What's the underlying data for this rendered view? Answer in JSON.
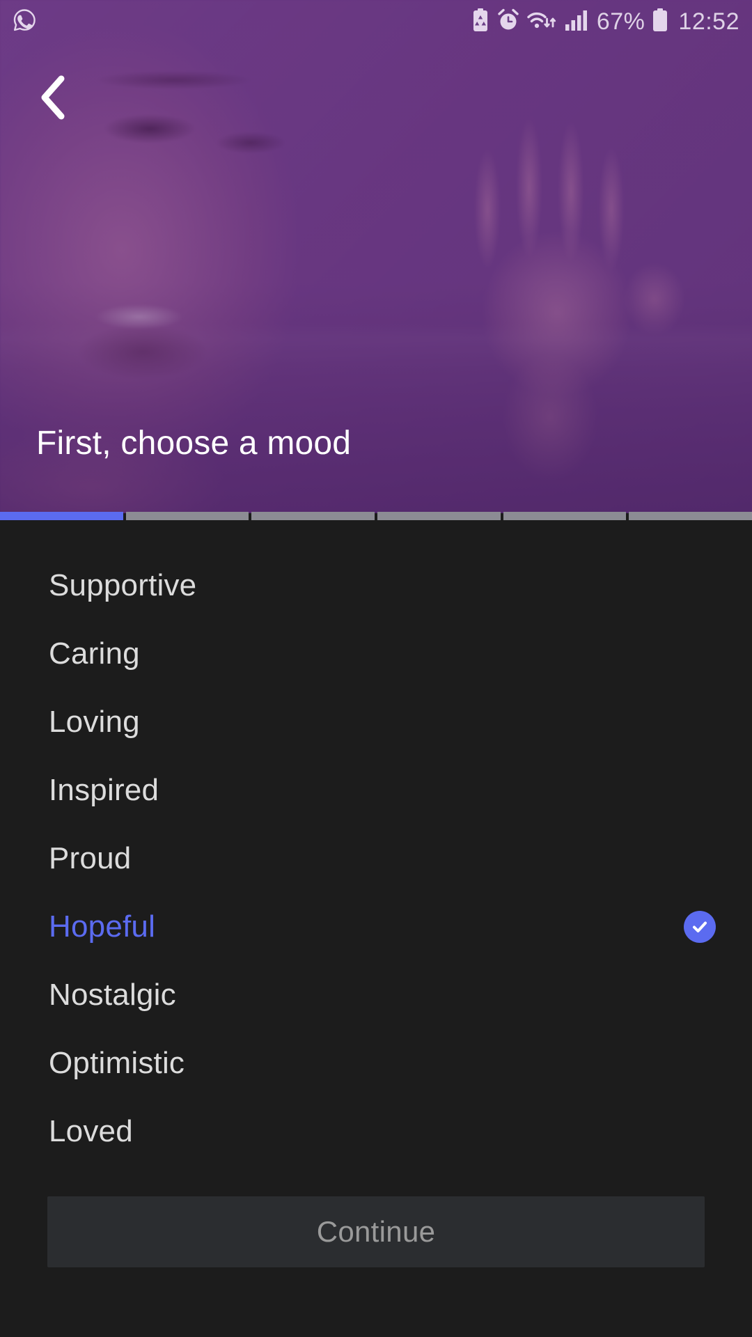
{
  "status_bar": {
    "notification_icon": "whatsapp-icon",
    "icons": [
      "battery-saver-icon",
      "alarm-clock-icon",
      "wifi-icon",
      "signal-bars-icon",
      "battery-icon"
    ],
    "battery_percent": "67%",
    "time": "12:52"
  },
  "hero": {
    "back_icon": "chevron-left-icon",
    "title": "First, choose a mood",
    "overlay_color": "#602c7a"
  },
  "progress": {
    "total_steps": 6,
    "current_step": 1,
    "active_color": "#5b6bf0",
    "inactive_color": "#8c8c94"
  },
  "mood_list": {
    "items": [
      {
        "label": "Supportive",
        "selected": false
      },
      {
        "label": "Caring",
        "selected": false
      },
      {
        "label": "Loving",
        "selected": false
      },
      {
        "label": "Inspired",
        "selected": false
      },
      {
        "label": "Proud",
        "selected": false
      },
      {
        "label": "Hopeful",
        "selected": true
      },
      {
        "label": "Nostalgic",
        "selected": false
      },
      {
        "label": "Optimistic",
        "selected": false
      },
      {
        "label": "Loved",
        "selected": false
      }
    ],
    "selected_value": "Hopeful",
    "check_icon": "check-icon",
    "selected_color": "#5b6bf0",
    "text_color": "#dcdcdc"
  },
  "footer": {
    "continue_label": "Continue",
    "continue_bg": "#2b2d30",
    "continue_text_color": "#9a9a9a"
  }
}
